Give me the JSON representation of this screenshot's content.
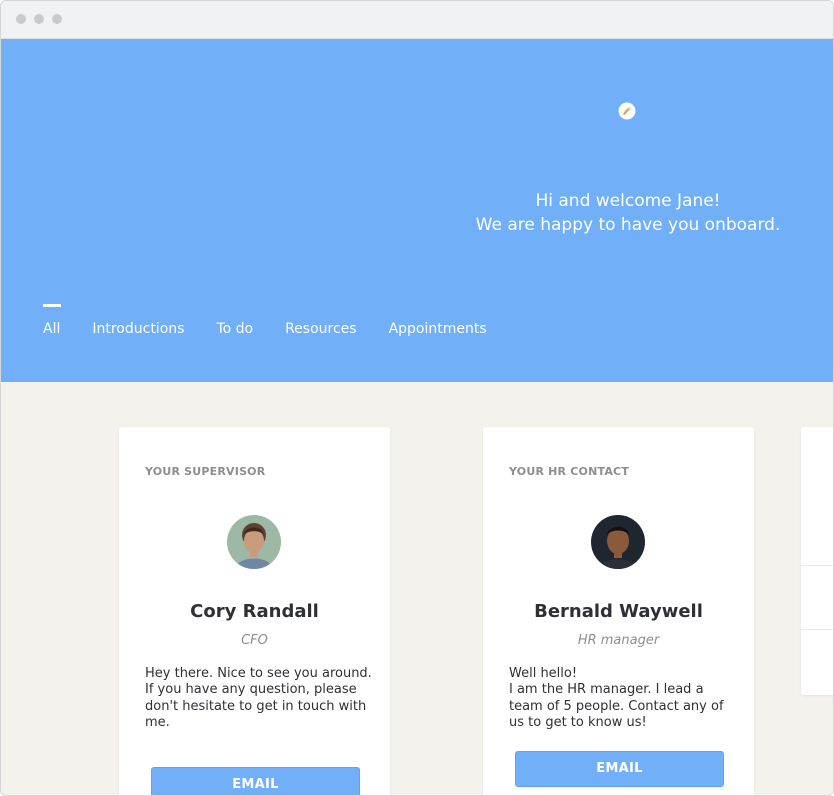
{
  "window": {
    "controls": [
      "close",
      "minimize",
      "maximize"
    ]
  },
  "hero": {
    "logo_icon": "feather-logo-icon",
    "welcome_line1": "Hi and welcome Jane!",
    "welcome_line2": "We are happy to have you onboard."
  },
  "tabs": [
    {
      "label": "All",
      "active": true
    },
    {
      "label": "Introductions",
      "active": false
    },
    {
      "label": "To do",
      "active": false
    },
    {
      "label": "Resources",
      "active": false
    },
    {
      "label": "Appointments",
      "active": false
    }
  ],
  "cards": [
    {
      "label": "YOUR SUPERVISOR",
      "name": "Cory Randall",
      "role": "CFO",
      "message": "Hey there. Nice to see you around.\nIf you have any question, please don't hesitate to get in touch with me.",
      "button": "EMAIL"
    },
    {
      "label": "YOUR HR CONTACT",
      "name": "Bernald Waywell",
      "role": "HR manager",
      "message": "Well hello!\nI am the HR manager. I lead a team of 5 people. Contact any of us to get to know us!",
      "button": "EMAIL"
    }
  ],
  "colors": {
    "hero": "#71b0f8",
    "background": "#f4f2ec",
    "button": "#71b0f8",
    "logo_orange": "#f6a623"
  }
}
